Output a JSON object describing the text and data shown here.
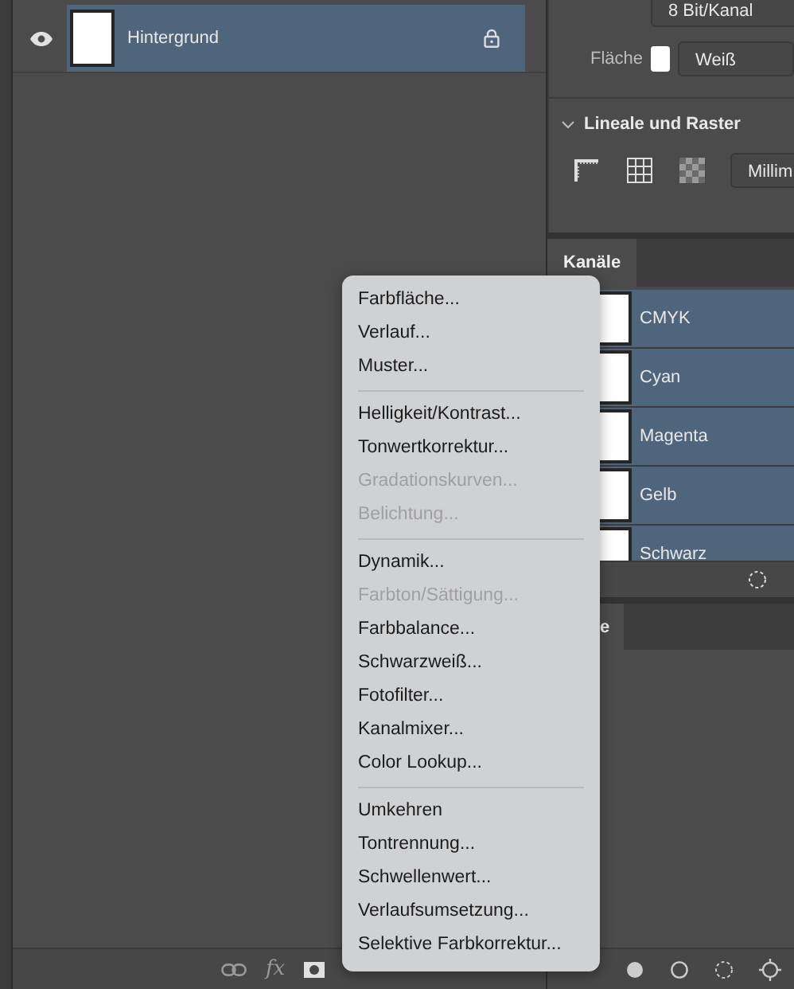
{
  "layers_panel": {
    "layers": [
      {
        "name": "Hintergrund",
        "visible": true,
        "locked": true,
        "selected": true
      }
    ],
    "footer": {
      "fx_label": "fx"
    }
  },
  "properties_panel": {
    "depth": "8 Bit/Kanal",
    "fill_label": "Fläche",
    "fill_value": "Weiß",
    "section": {
      "title": "Lineale und Raster",
      "expanded": true
    },
    "units": "Millim"
  },
  "channels_panel": {
    "tabs": [
      {
        "label": "Kanäle",
        "selected": true
      }
    ],
    "channels": [
      {
        "name": "CMYK",
        "selected": true
      },
      {
        "name": "Cyan",
        "selected": true
      },
      {
        "name": "Magenta",
        "selected": true
      },
      {
        "name": "Gelb",
        "selected": true
      },
      {
        "name": "Schwarz",
        "selected": true
      }
    ]
  },
  "lower_panel": {
    "tabs": [
      {
        "label": "e",
        "selected": true
      }
    ]
  },
  "adjustment_menu": {
    "groups": [
      [
        {
          "label": "Farbfläche...",
          "disabled": false
        },
        {
          "label": "Verlauf...",
          "disabled": false
        },
        {
          "label": "Muster...",
          "disabled": false
        }
      ],
      [
        {
          "label": "Helligkeit/Kontrast...",
          "disabled": false
        },
        {
          "label": "Tonwertkorrektur...",
          "disabled": false
        },
        {
          "label": "Gradationskurven...",
          "disabled": true
        },
        {
          "label": "Belichtung...",
          "disabled": true
        }
      ],
      [
        {
          "label": "Dynamik...",
          "disabled": false
        },
        {
          "label": "Farbton/Sättigung...",
          "disabled": true
        },
        {
          "label": "Farbbalance...",
          "disabled": false
        },
        {
          "label": "Schwarzweiß...",
          "disabled": false
        },
        {
          "label": "Fotofilter...",
          "disabled": false
        },
        {
          "label": "Kanalmixer...",
          "disabled": false
        },
        {
          "label": "Color Lookup...",
          "disabled": false
        }
      ],
      [
        {
          "label": "Umkehren",
          "disabled": false
        },
        {
          "label": "Tontrennung...",
          "disabled": false
        },
        {
          "label": "Schwellenwert...",
          "disabled": false
        },
        {
          "label": "Verlaufsumsetzung...",
          "disabled": false
        },
        {
          "label": "Selektive Farbkorrektur...",
          "disabled": false
        }
      ]
    ]
  }
}
